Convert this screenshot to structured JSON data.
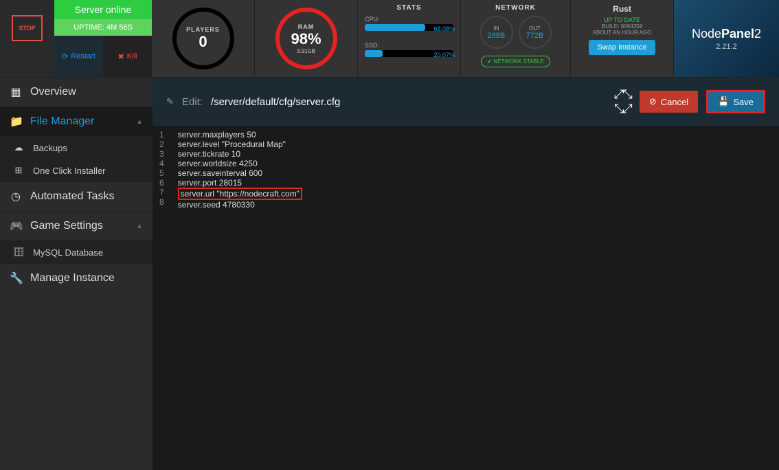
{
  "status": {
    "stop": "STOP",
    "online": "Server online",
    "uptime": "UPTIME: 4M 56S",
    "restart": "Restart",
    "kill": "Kill"
  },
  "players": {
    "label": "PLAYERS",
    "value": "0"
  },
  "ram": {
    "label": "RAM",
    "value": "98%",
    "sub": "3.91GB"
  },
  "stats": {
    "title": "STATS",
    "cpu_label": "CPU:",
    "cpu_pct": "68.08%",
    "ssd_label": "SSD:",
    "ssd_pct": "20.07%"
  },
  "network": {
    "title": "NETWORK",
    "in_label": "IN",
    "in_val": "268B",
    "out_label": "OUT",
    "out_val": "772B",
    "stable": "NETWORK STABLE"
  },
  "game": {
    "name": "Rust",
    "status": "UP TO DATE",
    "build": "BUILD: 6064359",
    "ago": "ABOUT AN HOUR AGO",
    "swap": "Swap Instance"
  },
  "brand": {
    "name_light": "Node",
    "name_bold": "Panel",
    "num": "2",
    "ver": "2.21.2"
  },
  "nav": {
    "overview": "Overview",
    "filemanager": "File Manager",
    "backups": "Backups",
    "oneclick": "One Click Installer",
    "automated": "Automated Tasks",
    "gamesettings": "Game Settings",
    "mysql": "MySQL Database",
    "manage": "Manage Instance"
  },
  "editbar": {
    "label": "Edit:",
    "path": "/server/default/cfg/server.cfg",
    "cancel": "Cancel",
    "save": "Save"
  },
  "code": {
    "lines": [
      "server.maxplayers 50",
      "server.level \"Procedural Map\"",
      "server.tickrate 10",
      "server.worldsize 4250",
      "server.saveinterval 600",
      "server.port 28015",
      "server.url \"https://nodecraft.com\"",
      "server.seed 4780330"
    ],
    "highlight_index": 6
  }
}
